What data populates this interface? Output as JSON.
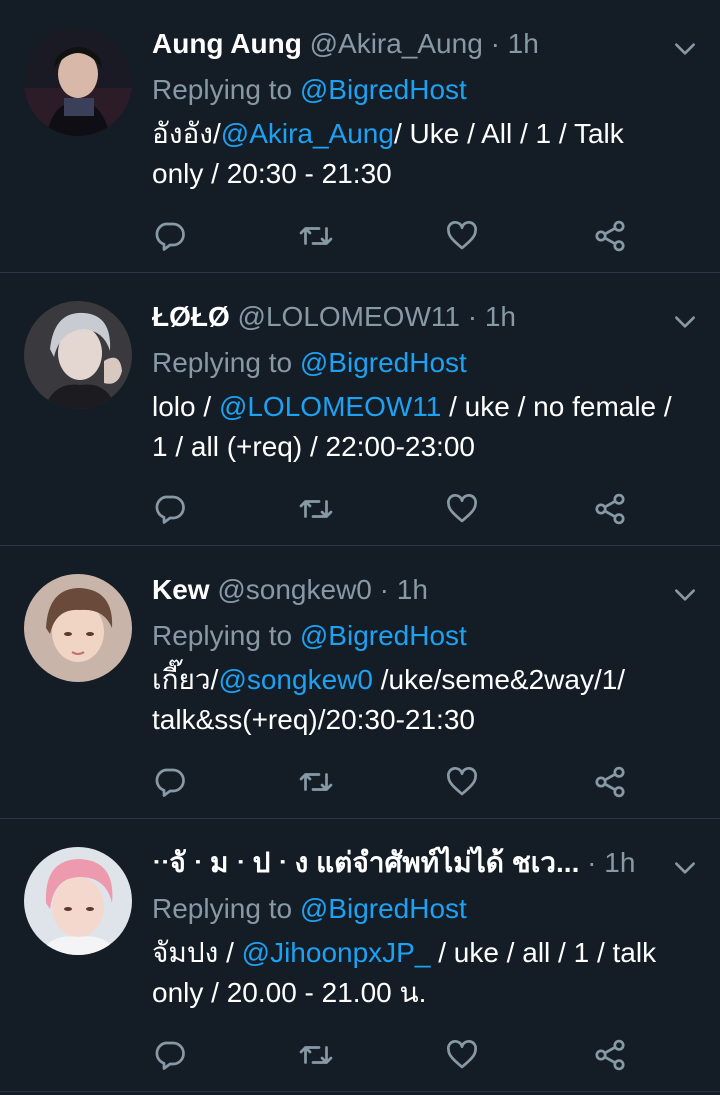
{
  "colors": {
    "background": "#141d26",
    "link": "#1da1f2",
    "muted": "#8899a6",
    "divider": "#2a3744"
  },
  "icons": {
    "reply": "reply-icon",
    "retweet": "retweet-icon",
    "like": "heart-icon",
    "share": "share-icon",
    "more": "chevron-down-icon"
  },
  "tweets": [
    {
      "name": "Aung Aung",
      "handle": "@Akira_Aung",
      "dot": "·",
      "time": "1h",
      "replying_prefix": "Replying to",
      "replying_to": "@BigredHost",
      "text_before": "อังอัง/",
      "mention": "@Akira_Aung",
      "text_after": "/ Uke / All / 1 / Talk only / 20:30 - 21:30"
    },
    {
      "name": "ŁØŁØ",
      "handle": "@LOLOMEOW11",
      "dot": "·",
      "time": "1h",
      "replying_prefix": "Replying to",
      "replying_to": "@BigredHost",
      "text_before": "lolo / ",
      "mention": "@LOLOMEOW11",
      "text_after": " / uke / no female / 1 / all (+req) / 22:00-23:00"
    },
    {
      "name": "Kew",
      "handle": "@songkew0",
      "dot": "·",
      "time": "1h",
      "replying_prefix": "Replying to",
      "replying_to": "@BigredHost",
      "text_before": "เกี๊ยว/",
      "mention": "@songkew0",
      "text_after": " /uke/seme&2way/1/ talk&ss(+req)/20:30-21:30"
    },
    {
      "name": "ᐧᐧจั ᐧ ม ᐧ ป ᐧ ง แต่จำศัพท์ไม่ได้ ชเว...",
      "handle": "",
      "dot": "·",
      "time": "1h",
      "replying_prefix": "Replying to",
      "replying_to": "@BigredHost",
      "text_before": "จัมปง / ",
      "mention": "@JihoonpxJP_",
      "text_after": "  / uke / all / 1 / talk only / 20.00 - 21.00 น."
    }
  ]
}
